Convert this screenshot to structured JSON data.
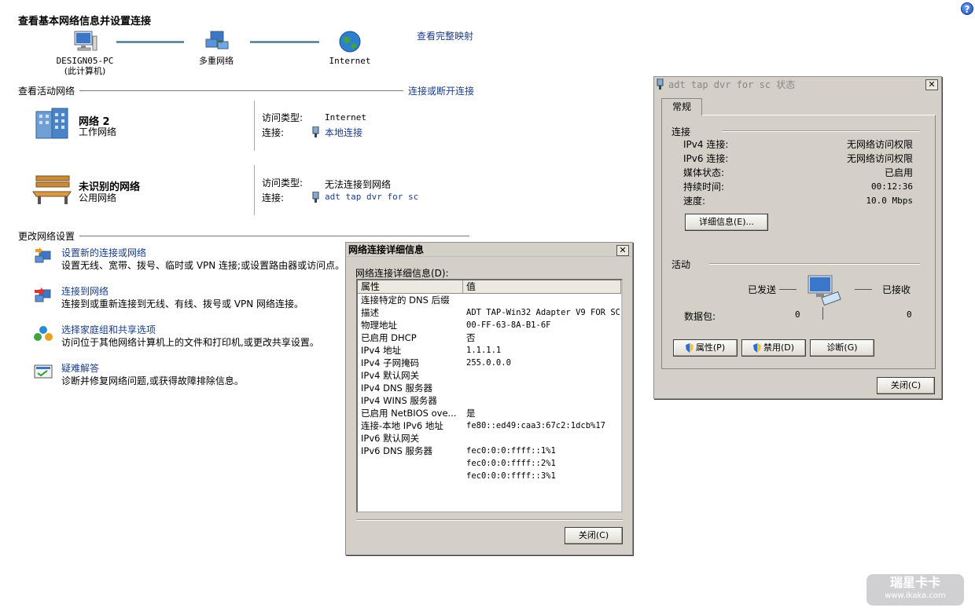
{
  "header": {
    "title": "查看基本网络信息并设置连接",
    "full_map_link": "查看完整映射"
  },
  "network_map": {
    "computer": {
      "name": "DESIGN05-PC",
      "sub": "(此计算机)"
    },
    "middle": {
      "name": "多重网络"
    },
    "internet": {
      "name": "Internet"
    }
  },
  "active_networks": {
    "header": "查看活动网络",
    "connect_link": "连接或断开连接",
    "networks": [
      {
        "name": "网络  2",
        "type": "工作网络",
        "access_label": "访问类型:",
        "access_value": "Internet",
        "conn_label": "连接:",
        "conn_value": "本地连接"
      },
      {
        "name": "未识别的网络",
        "type": "公用网络",
        "access_label": "访问类型:",
        "access_value": "无法连接到网络",
        "conn_label": "连接:",
        "conn_value": "adt tap dvr for sc"
      }
    ]
  },
  "change_settings": {
    "header": "更改网络设置",
    "tasks": [
      {
        "title": "设置新的连接或网络",
        "desc": "设置无线、宽带、拨号、临时或 VPN 连接;或设置路由器或访问点。",
        "icon": "network-setup-icon"
      },
      {
        "title": "连接到网络",
        "desc": "连接到或重新连接到无线、有线、拨号或 VPN 网络连接。",
        "icon": "connect-network-icon"
      },
      {
        "title": "选择家庭组和共享选项",
        "desc": "访问位于其他网络计算机上的文件和打印机,或更改共享设置。",
        "icon": "homegroup-icon"
      },
      {
        "title": "疑难解答",
        "desc": "诊断并修复网络问题,或获得故障排除信息。",
        "icon": "troubleshoot-icon"
      }
    ]
  },
  "details_dialog": {
    "title": "网络连接详细信息",
    "list_label": "网络连接详细信息(D):",
    "col_property": "属性",
    "col_value": "值",
    "rows": [
      {
        "p": "连接特定的 DNS 后缀",
        "v": ""
      },
      {
        "p": "描述",
        "v": "ADT TAP-Win32 Adapter V9 FOR SC"
      },
      {
        "p": "物理地址",
        "v": "00-FF-63-8A-B1-6F"
      },
      {
        "p": "已启用 DHCP",
        "v": "否"
      },
      {
        "p": "IPv4 地址",
        "v": "1.1.1.1"
      },
      {
        "p": "IPv4 子网掩码",
        "v": "255.0.0.0"
      },
      {
        "p": "IPv4 默认网关",
        "v": ""
      },
      {
        "p": "IPv4 DNS 服务器",
        "v": ""
      },
      {
        "p": "IPv4 WINS 服务器",
        "v": ""
      },
      {
        "p": "已启用 NetBIOS ove...",
        "v": "是"
      },
      {
        "p": "连接-本地 IPv6 地址",
        "v": "fe80::ed49:caa3:67c2:1dcb%17"
      },
      {
        "p": "IPv6 默认网关",
        "v": ""
      },
      {
        "p": "IPv6 DNS 服务器",
        "v": "fec0:0:0:ffff::1%1"
      },
      {
        "p": "",
        "v": "fec0:0:0:ffff::2%1"
      },
      {
        "p": "",
        "v": "fec0:0:0:ffff::3%1"
      }
    ],
    "close_button": "关闭(C)"
  },
  "status_dialog": {
    "title": "adt tap dvr for sc 状态",
    "tab": "常规",
    "connection_group": "连接",
    "rows": [
      {
        "label": "IPv4 连接:",
        "value": "无网络访问权限"
      },
      {
        "label": "IPv6 连接:",
        "value": "无网络访问权限"
      },
      {
        "label": "媒体状态:",
        "value": "已启用"
      },
      {
        "label": "持续时间:",
        "value": "00:12:36"
      },
      {
        "label": "速度:",
        "value": "10.0 Mbps"
      }
    ],
    "details_button": "详细信息(E)...",
    "activity_group": "活动",
    "sent_label": "已发送",
    "received_label": "已接收",
    "packets_label": "数据包:",
    "packets_sent": "0",
    "packets_received": "0",
    "properties_button": "属性(P)",
    "disable_button": "禁用(D)",
    "diagnose_button": "诊断(G)",
    "close_button": "关闭(C)"
  },
  "watermark": {
    "line1": "瑞星卡卡",
    "line2": "www.ikaka.com"
  }
}
